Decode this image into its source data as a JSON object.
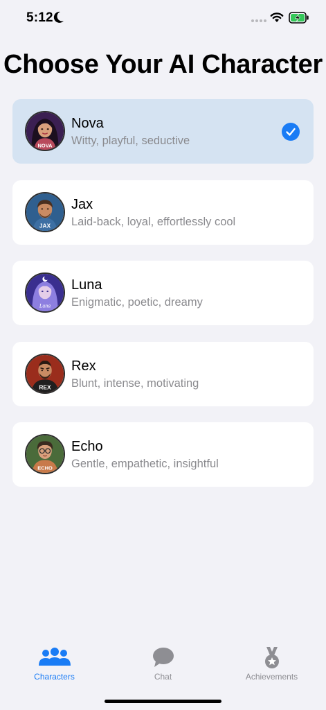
{
  "status_bar": {
    "time": "5:12"
  },
  "title": "Choose Your AI Character",
  "characters": [
    {
      "name": "Nova",
      "description": "Witty, playful, seductive",
      "avatar_label": "NOVA",
      "selected": true
    },
    {
      "name": "Jax",
      "description": "Laid-back, loyal, effortlessly cool",
      "avatar_label": "JAX",
      "selected": false
    },
    {
      "name": "Luna",
      "description": "Enigmatic, poetic, dreamy",
      "avatar_label": "Luna",
      "selected": false
    },
    {
      "name": "Rex",
      "description": "Blunt, intense, motivating",
      "avatar_label": "REX",
      "selected": false
    },
    {
      "name": "Echo",
      "description": "Gentle, empathetic, insightful",
      "avatar_label": "ECHO",
      "selected": false
    }
  ],
  "tabs": [
    {
      "label": "Characters",
      "icon": "people-icon",
      "active": true
    },
    {
      "label": "Chat",
      "icon": "chat-bubble-icon",
      "active": false
    },
    {
      "label": "Achievements",
      "icon": "medal-icon",
      "active": false
    }
  ],
  "colors": {
    "accent": "#1a7cf5",
    "selected_card": "#d5e3f2",
    "background": "#f2f2f7",
    "subtitle": "#8a8a8e"
  }
}
